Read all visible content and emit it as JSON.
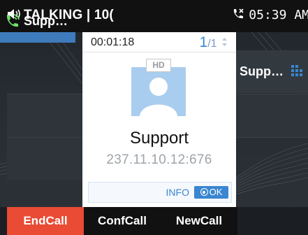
{
  "status_bar": {
    "call_state": "TALKING | 10(",
    "time": "05:39 AM",
    "speaker_icon": "speaker-icon",
    "phone_icon": "phone-missed-icon"
  },
  "lines": {
    "left_active_label": "Supp…",
    "left_active_icon": "phone-call-icon",
    "right_label": "Supp…",
    "right_icon": "dialpad-icon"
  },
  "popup": {
    "duration": "00:01:18",
    "page_current": "1",
    "page_total": "/1",
    "hd_badge": "HD",
    "contact_name": "Support",
    "contact_address": "237.11.10.12:676",
    "info_label": "INFO",
    "ok_label": "OK"
  },
  "softkeys": [
    {
      "label": "EndCall"
    },
    {
      "label": "ConfCall"
    },
    {
      "label": "NewCall"
    }
  ],
  "colors": {
    "accent_blue": "#3a86d1",
    "end_call_red": "#e94b35",
    "active_line": "#3d7bbd"
  }
}
